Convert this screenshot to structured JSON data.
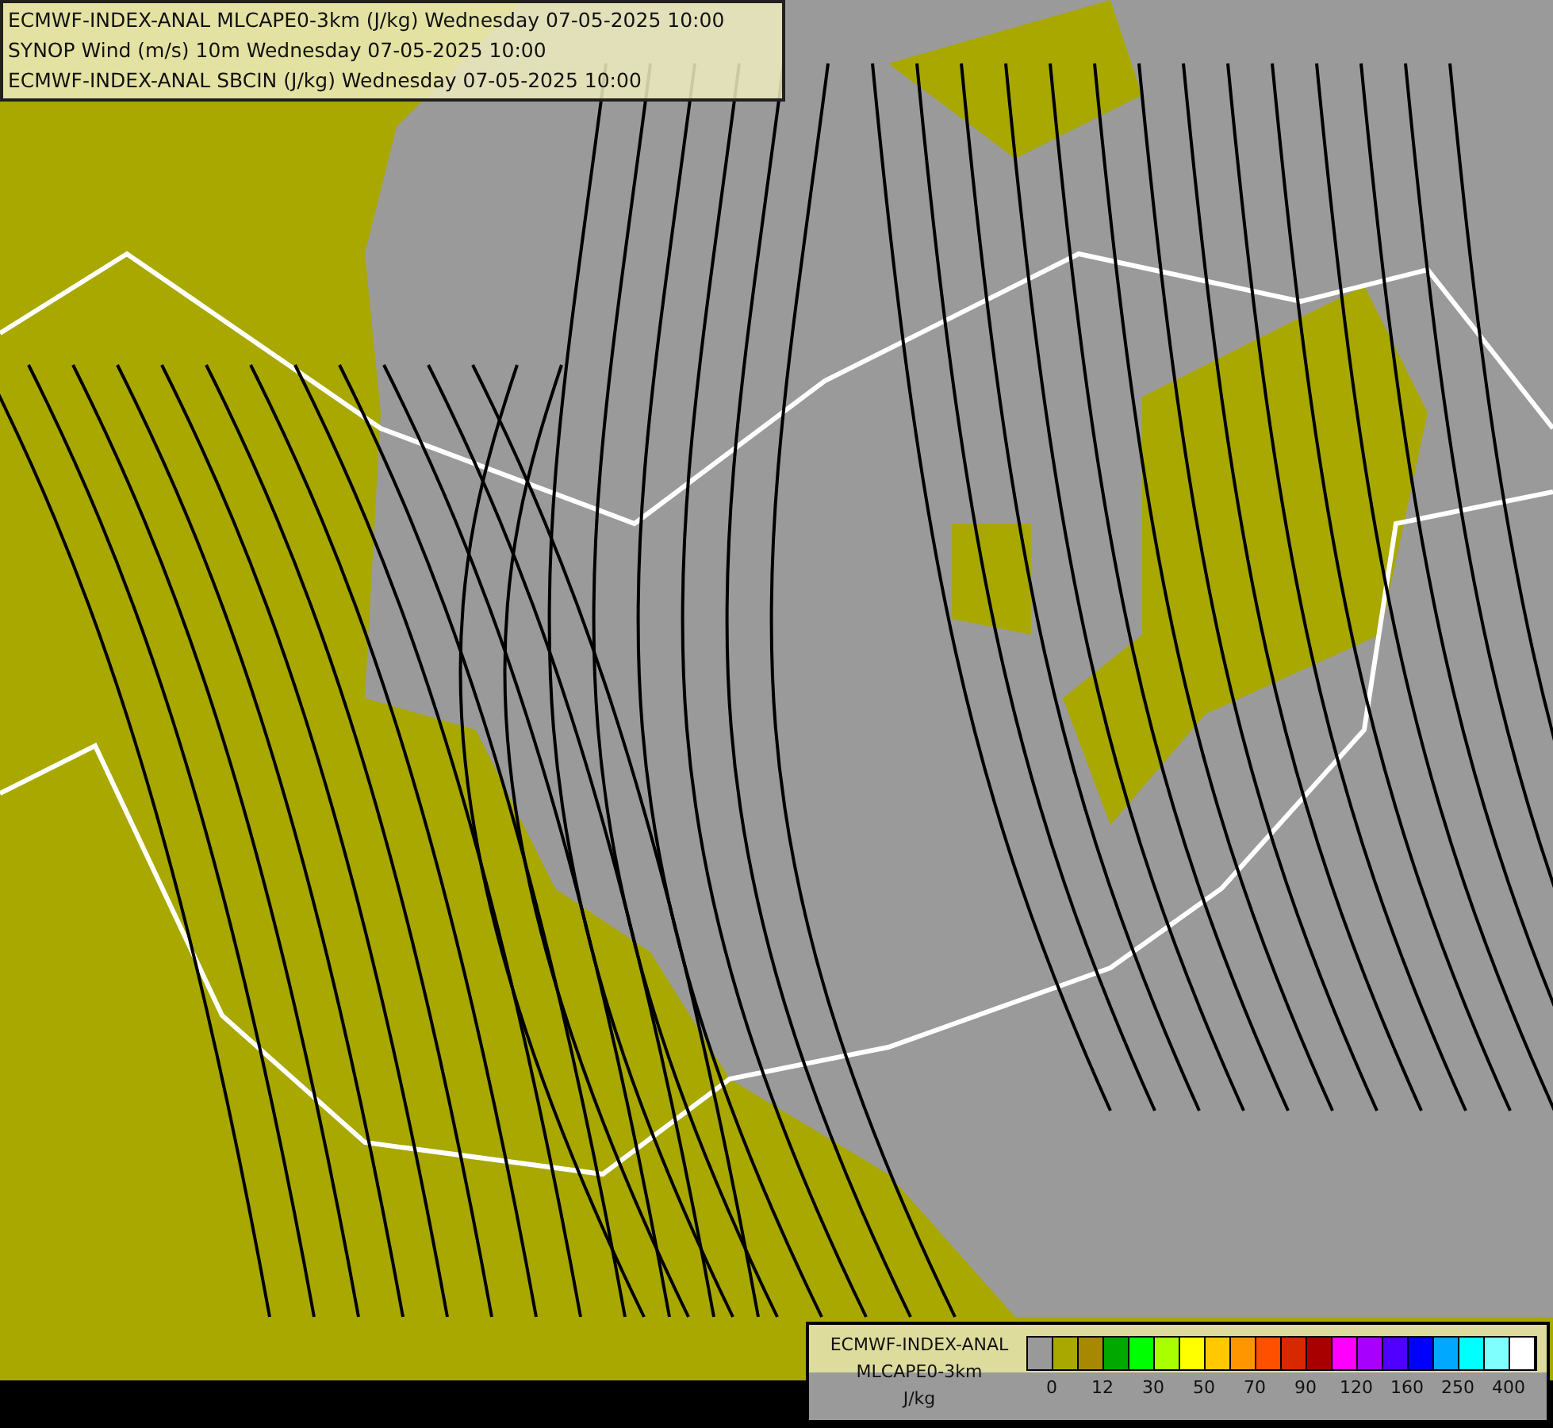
{
  "header": {
    "lines": [
      "ECMWF-INDEX-ANAL MLCAPE0-3km (J/kg) Wednesday 07-05-2025 10:00",
      "SYNOP Wind (m/s) 10m Wednesday 07-05-2025 10:00",
      "ECMWF-INDEX-ANAL SBCIN (J/kg) Wednesday 07-05-2025 10:00"
    ]
  },
  "legend": {
    "title": "ECMWF-INDEX-ANAL",
    "subtitle": "MLCAPE0-3km",
    "unit": "J/kg",
    "swatches": [
      {
        "color": "#999999"
      },
      {
        "color": "#a8a800"
      },
      {
        "color": "#a88800"
      },
      {
        "color": "#00a800"
      },
      {
        "color": "#00ff00"
      },
      {
        "color": "#a8ff00"
      },
      {
        "color": "#ffff00"
      },
      {
        "color": "#ffc800"
      },
      {
        "color": "#ff9600"
      },
      {
        "color": "#ff5000"
      },
      {
        "color": "#d82800"
      },
      {
        "color": "#a80000"
      },
      {
        "color": "#ff00ff"
      },
      {
        "color": "#a800ff"
      },
      {
        "color": "#5000ff"
      },
      {
        "color": "#0000ff"
      },
      {
        "color": "#00a8ff"
      },
      {
        "color": "#00ffff"
      },
      {
        "color": "#80ffff"
      },
      {
        "color": "#ffffff"
      }
    ],
    "ticks": [
      "0",
      "12",
      "30",
      "50",
      "70",
      "90",
      "120",
      "160",
      "250",
      "400"
    ]
  }
}
